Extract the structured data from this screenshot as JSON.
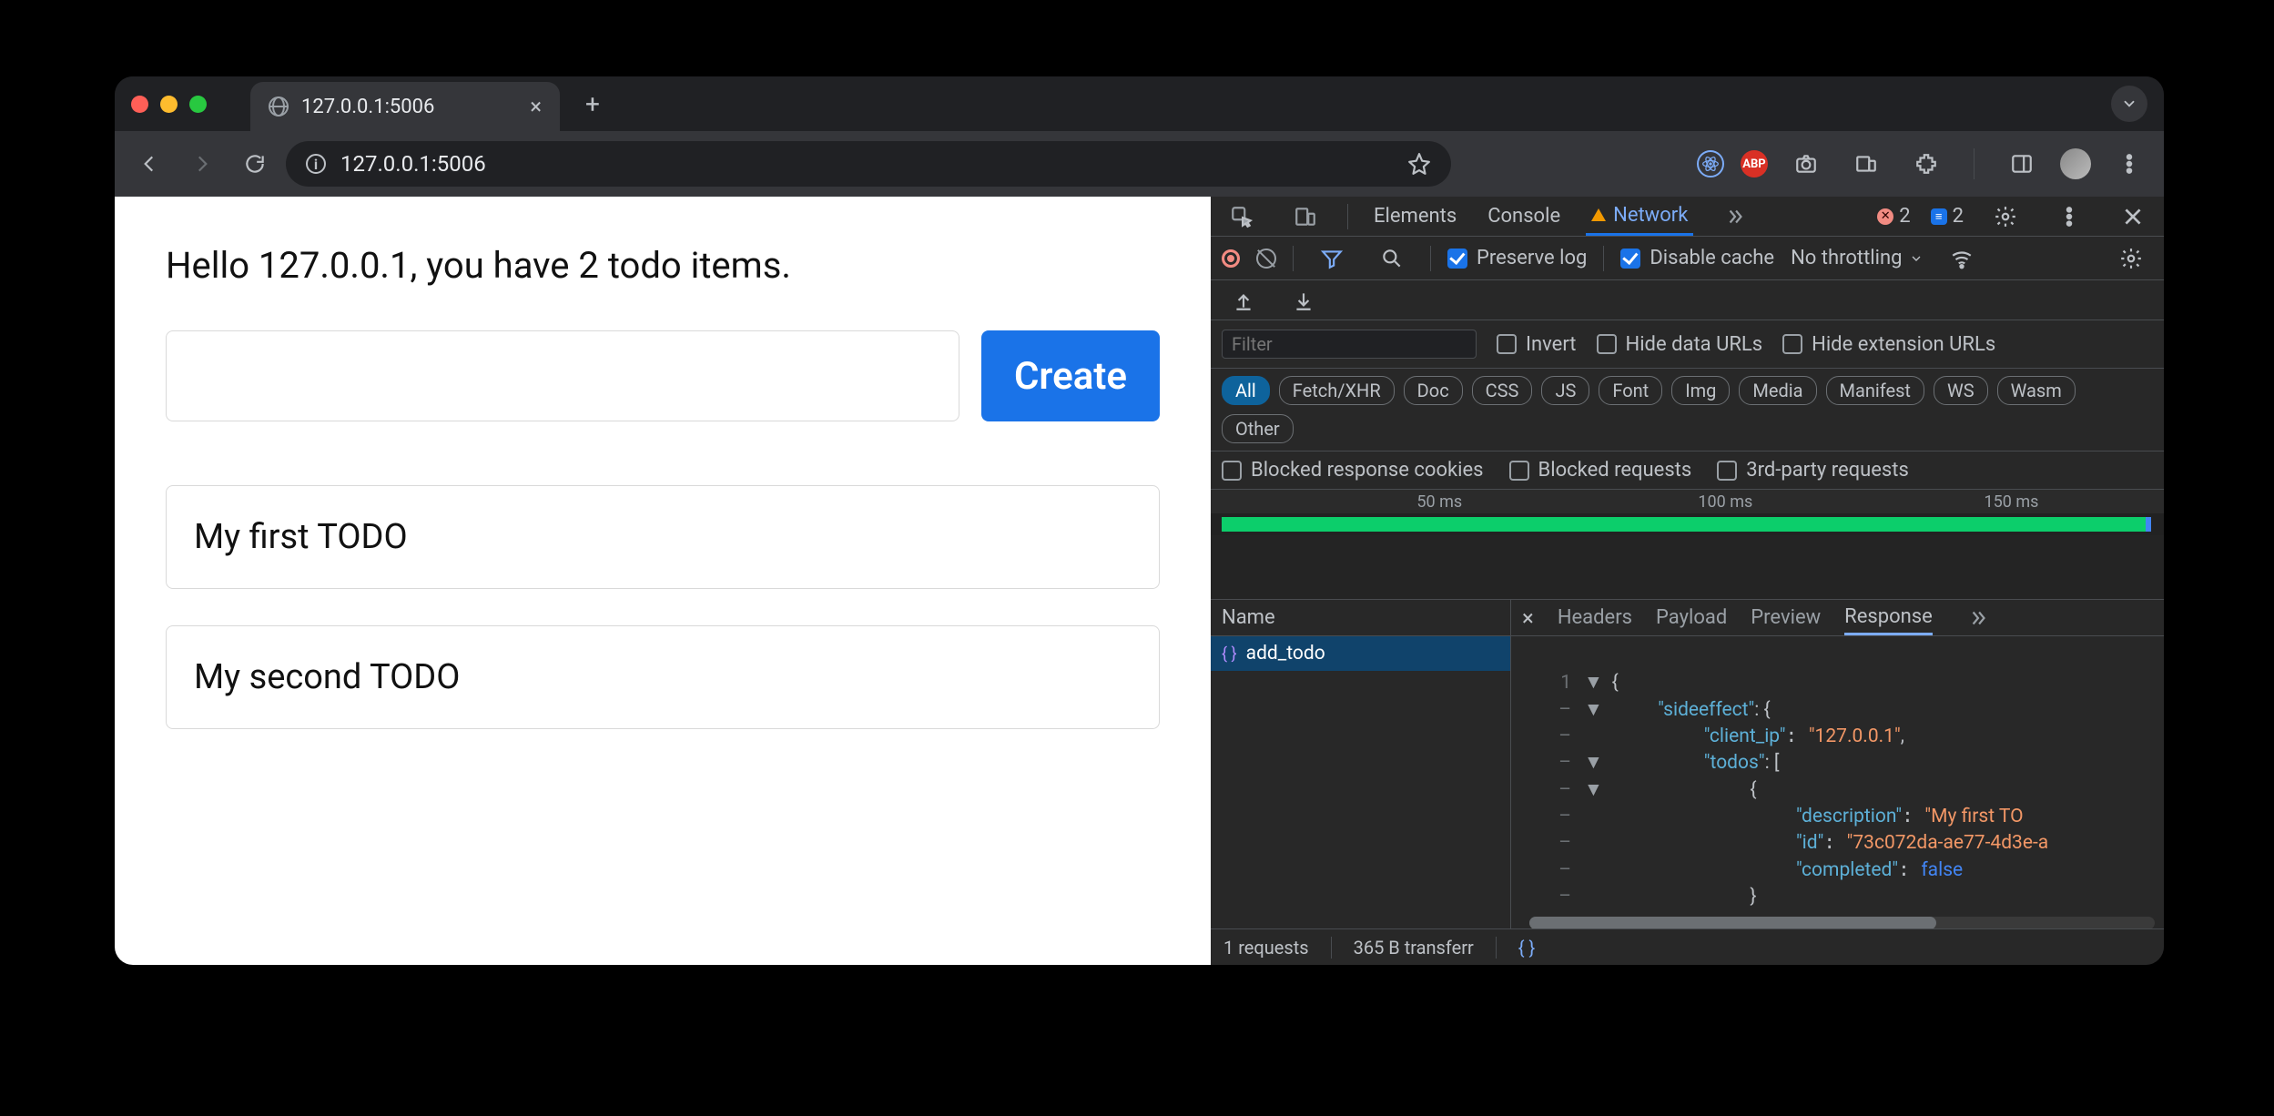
{
  "browser": {
    "tab_title": "127.0.0.1:5006",
    "url": "127.0.0.1:5006",
    "extensions": {
      "abp": "ABP"
    }
  },
  "page": {
    "heading": "Hello 127.0.0.1, you have 2 todo items.",
    "create_button": "Create",
    "new_todo_value": "",
    "todos": [
      "My first TODO",
      "My second TODO"
    ]
  },
  "devtools": {
    "tabs": {
      "elements": "Elements",
      "console": "Console",
      "network": "Network"
    },
    "errors_count": "2",
    "messages_count": "2",
    "toolbar": {
      "preserve_log": "Preserve log",
      "disable_cache": "Disable cache",
      "throttling": "No throttling"
    },
    "filter_placeholder": "Filter",
    "filter_checks": {
      "invert": "Invert",
      "hide_data_urls": "Hide data URLs",
      "hide_ext_urls": "Hide extension URLs"
    },
    "type_chips": [
      "All",
      "Fetch/XHR",
      "Doc",
      "CSS",
      "JS",
      "Font",
      "Img",
      "Media",
      "Manifest",
      "WS",
      "Wasm",
      "Other"
    ],
    "blocked_checks": {
      "blocked_cookies": "Blocked response cookies",
      "blocked_requests": "Blocked requests",
      "third_party": "3rd-party requests"
    },
    "timeline_ticks": [
      "50 ms",
      "100 ms",
      "150 ms"
    ],
    "name_header": "Name",
    "requests": [
      {
        "name": "add_todo"
      }
    ],
    "response_tabs": {
      "headers": "Headers",
      "payload": "Payload",
      "preview": "Preview",
      "response": "Response"
    },
    "response_json": {
      "line1_num": "1",
      "line1": "{",
      "line2": "\"sideeffect\"",
      "line2_a": ": {",
      "line3": "\"client_ip\"",
      "line3_v": "\"127.0.0.1\"",
      "line3_c": ",",
      "line4": "\"todos\"",
      "line4_a": ": [",
      "line5": "{",
      "line6": "\"description\"",
      "line6_v": "\"My first TO",
      "line7": "\"id\"",
      "line7_v": "\"73c072da-ae77-4d3e-a",
      "line8": "\"completed\"",
      "line8_v": "false",
      "line9": "}"
    },
    "status": {
      "requests": "1 requests",
      "transferred": "365 B transferr"
    }
  }
}
